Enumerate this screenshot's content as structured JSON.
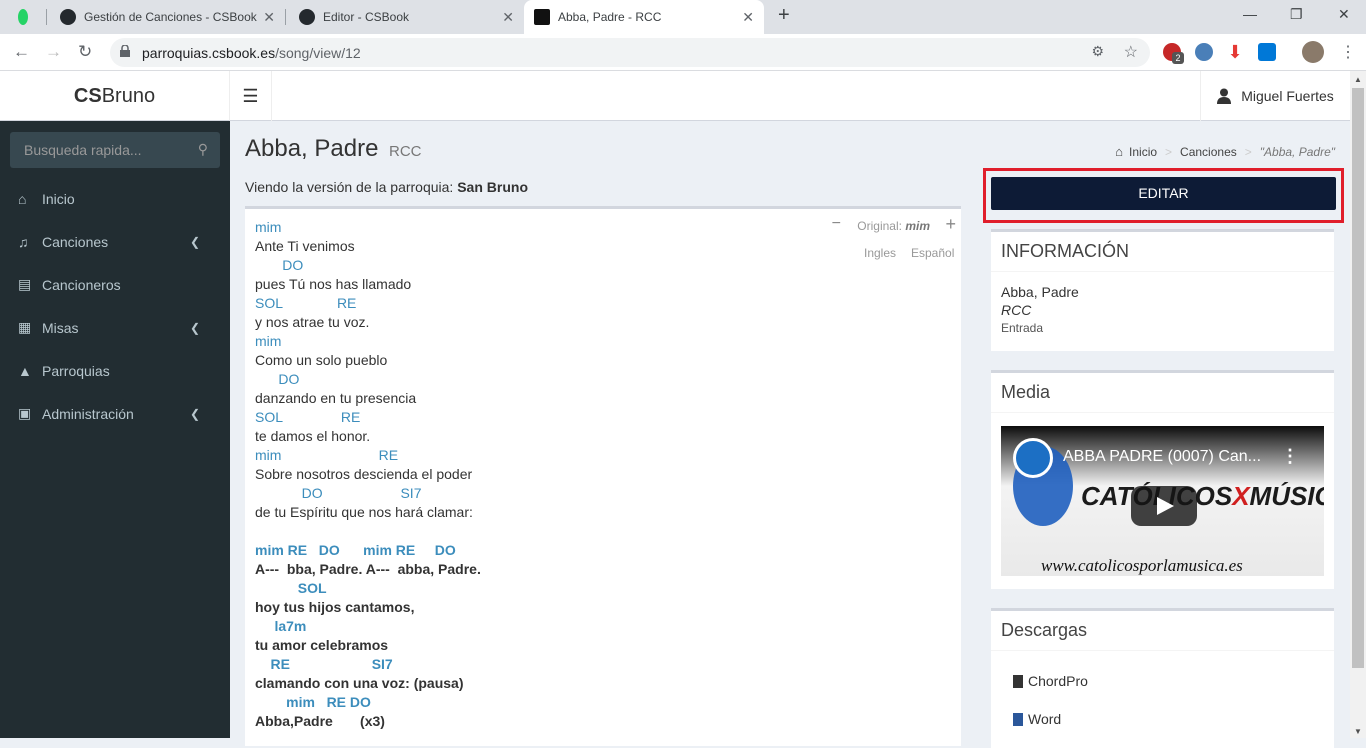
{
  "browser": {
    "tabs": [
      {
        "label": ""
      },
      {
        "label": "Gestión de Canciones - CSBook"
      },
      {
        "label": "Editor - CSBook"
      },
      {
        "label": "Abba, Padre - RCC"
      }
    ],
    "url_host": "parroquias.csbook.es",
    "url_path": "/song/view/12",
    "ext_badge": "2"
  },
  "app": {
    "logo_bold": "CS",
    "logo_rest": "Bruno",
    "user_name": "Miguel Fuertes"
  },
  "sidebar": {
    "search_placeholder": "Busqueda rapida...",
    "items": [
      {
        "label": "Inicio",
        "icon": "home-icon",
        "has_chevron": false
      },
      {
        "label": "Canciones",
        "icon": "music-icon",
        "has_chevron": true
      },
      {
        "label": "Cancioneros",
        "icon": "book-icon",
        "has_chevron": false
      },
      {
        "label": "Misas",
        "icon": "calendar-icon",
        "has_chevron": true
      },
      {
        "label": "Parroquias",
        "icon": "sitemap-icon",
        "has_chevron": false
      },
      {
        "label": "Administración",
        "icon": "briefcase-icon",
        "has_chevron": true
      }
    ]
  },
  "page": {
    "title": "Abba, Padre",
    "subtitle": "RCC",
    "breadcrumb": {
      "home": "Inicio",
      "section": "Canciones",
      "current": "\"Abba, Padre\""
    },
    "version_prefix": "Viendo la versión de la parroquia:",
    "version_parish": "San Bruno"
  },
  "song": {
    "original_label": "Original:",
    "original_key": "mim",
    "lang_en": "Ingles",
    "lang_es": "Español",
    "lines": [
      {
        "type": "chord",
        "text": "mim"
      },
      {
        "type": "lyric",
        "text": "Ante Ti venimos"
      },
      {
        "type": "chord",
        "text": "       DO"
      },
      {
        "type": "lyric",
        "text": "pues Tú nos has llamado"
      },
      {
        "type": "chord",
        "text": "SOL              RE"
      },
      {
        "type": "lyric",
        "text": "y nos atrae tu voz."
      },
      {
        "type": "chord",
        "text": "mim"
      },
      {
        "type": "lyric",
        "text": "Como un solo pueblo"
      },
      {
        "type": "chord",
        "text": "      DO"
      },
      {
        "type": "lyric",
        "text": "danzando en tu presencia"
      },
      {
        "type": "chord",
        "text": "SOL               RE"
      },
      {
        "type": "lyric",
        "text": "te damos el honor."
      },
      {
        "type": "chord",
        "text": "mim                         RE"
      },
      {
        "type": "lyric",
        "text": "Sobre nosotros descienda el poder"
      },
      {
        "type": "chord",
        "text": "            DO                    SI7"
      },
      {
        "type": "lyric",
        "text": "de tu Espíritu que nos hará clamar:"
      },
      {
        "type": "blank",
        "text": ""
      },
      {
        "type": "chord-bold",
        "text": "mim RE   DO      mim RE     DO"
      },
      {
        "type": "lyric-bold",
        "text": "A---  bba, Padre. A---  abba, Padre."
      },
      {
        "type": "chord-bold",
        "text": "           SOL"
      },
      {
        "type": "lyric-bold",
        "text": "hoy tus hijos cantamos,"
      },
      {
        "type": "chord-bold",
        "text": "     la7m"
      },
      {
        "type": "lyric-bold",
        "text": "tu amor celebramos"
      },
      {
        "type": "chord-bold",
        "text": "    RE                     SI7"
      },
      {
        "type": "lyric-bold",
        "text": "clamando con una voz: (pausa)"
      },
      {
        "type": "chord-bold",
        "text": "        mim   RE DO"
      },
      {
        "type": "lyric-bold",
        "text": "Abba,Padre       (x3)"
      }
    ]
  },
  "right": {
    "edit_label": "EDITAR",
    "info": {
      "heading": "INFORMACIÓN",
      "title": "Abba, Padre",
      "group": "RCC",
      "category": "Entrada"
    },
    "media": {
      "heading": "Media",
      "video_title": "ABBA PADRE (0007) Can...",
      "video_brand_left": "CATÓLICOS",
      "video_brand_x": "X",
      "video_brand_right": "MÚSICA",
      "video_url": "www.catolicosporlamusica.es"
    },
    "downloads": {
      "heading": "Descargas",
      "items": [
        "ChordPro",
        "Word"
      ]
    }
  },
  "colors": {
    "sidebar_bg": "#222d32",
    "chord": "#3c8dbc",
    "edit_btn": "#0d1b36",
    "highlight": "#e01e2b"
  }
}
